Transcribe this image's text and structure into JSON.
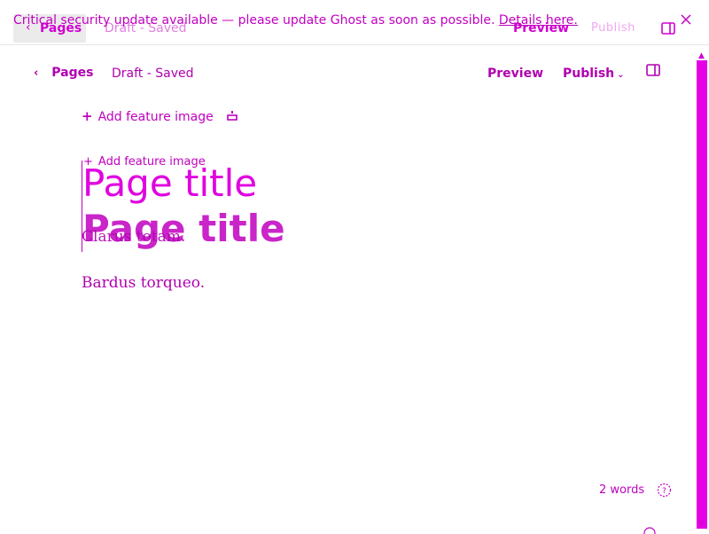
{
  "banner": {
    "message": "Critical security update available — please update Ghost as soon as possible.",
    "link_text": "Details here."
  },
  "ghost_header": {
    "back_label": "Pages",
    "status": "Draft - Saved",
    "preview": "Preview",
    "publish": "Publish"
  },
  "header": {
    "back_label": "Pages",
    "status": "Draft - Saved",
    "preview": "Preview",
    "publish": "Publish"
  },
  "editor": {
    "feature_image": "Add feature image",
    "ghost_feature_image": "Add feature image",
    "title": "Page title",
    "title_ghost": "Page title",
    "paragraphs": [
      "Clarus totam.",
      "Bardus torqueo."
    ]
  },
  "footer": {
    "word_count": "2 words"
  },
  "colors": {
    "accent": "#d100d1",
    "ghost_back_bg": "#ebebeb",
    "scrollbar": "#e600e6"
  },
  "icons": {
    "back": "chevron-left-icon",
    "sidebar": "sidebar-toggle-icon",
    "close": "close-icon",
    "add": "plus-icon",
    "help": "help-icon",
    "publish_caret": "chevron-down-icon"
  }
}
